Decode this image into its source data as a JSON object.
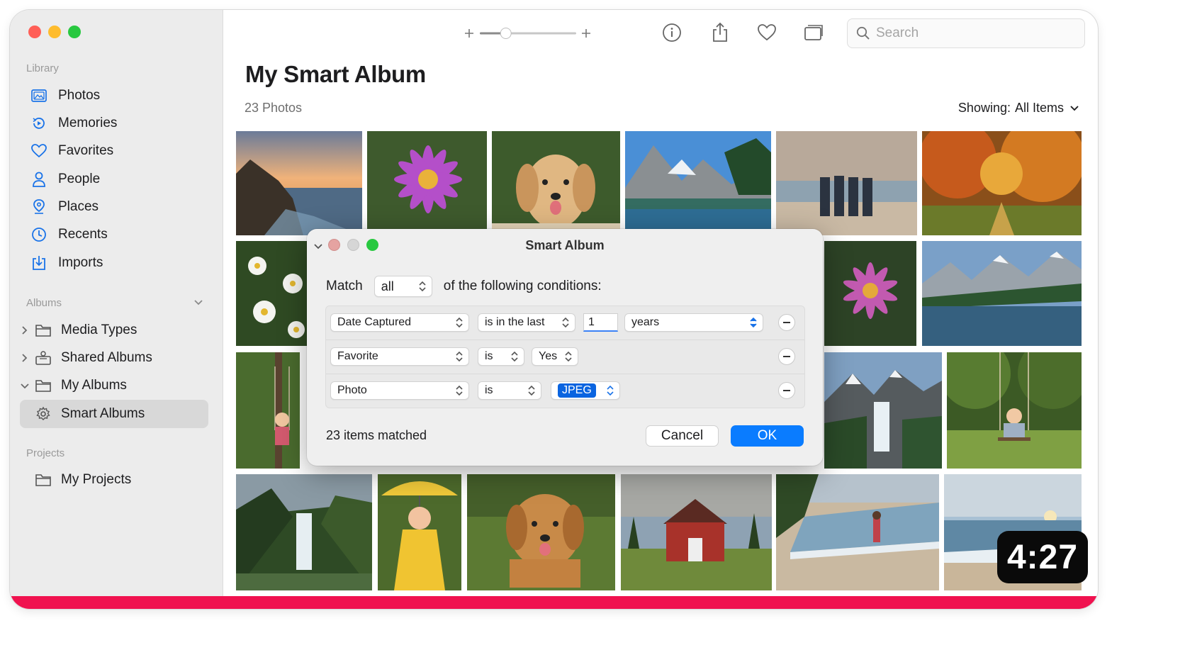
{
  "sidebar": {
    "library_label": "Library",
    "library_items": [
      {
        "label": "Photos",
        "icon": "photos-icon"
      },
      {
        "label": "Memories",
        "icon": "memories-icon"
      },
      {
        "label": "Favorites",
        "icon": "heart-icon"
      },
      {
        "label": "People",
        "icon": "person-icon"
      },
      {
        "label": "Places",
        "icon": "map-pin-icon"
      },
      {
        "label": "Recents",
        "icon": "clock-icon"
      },
      {
        "label": "Imports",
        "icon": "import-icon"
      }
    ],
    "albums_label": "Albums",
    "album_items": [
      {
        "label": "Media Types",
        "icon": "folder-icon",
        "expanded": false
      },
      {
        "label": "Shared Albums",
        "icon": "shared-albums-icon",
        "expanded": false
      },
      {
        "label": "My Albums",
        "icon": "folder-icon",
        "expanded": true
      },
      {
        "label": "Smart Albums",
        "icon": "gear-icon",
        "selected": true
      }
    ],
    "projects_label": "Projects",
    "project_items": [
      {
        "label": "My Projects",
        "icon": "folder-icon"
      }
    ]
  },
  "toolbar": {
    "search_placeholder": "Search",
    "zoom_level": 0.27
  },
  "main": {
    "title": "My Smart Album",
    "count": "23 Photos",
    "showing_label": "Showing:",
    "showing_value": "All Items"
  },
  "photos": [
    "coastal sunset",
    "purple flower",
    "golden retriever puppy",
    "mountain lake",
    "people on beach",
    "autumn trees",
    "daisies",
    "purple flower",
    "mountain lake reflection",
    "girl on swing",
    "waterfall in mountains",
    "child on swing",
    "forest waterfall",
    "child in yellow raincoat",
    "golden puppy",
    "red barn",
    "woman on beach",
    "ocean waves"
  ],
  "dialog": {
    "title": "Smart Album",
    "match_label": "Match",
    "match_value": "all",
    "match_suffix": "of the following conditions:",
    "conditions": [
      {
        "field": "Date Captured",
        "operator": "is in the last",
        "value": "1",
        "unit": "years"
      },
      {
        "field": "Favorite",
        "operator": "is",
        "value": "Yes"
      },
      {
        "field": "Photo",
        "operator": "is",
        "value": "JPEG"
      }
    ],
    "matched": "23 items matched",
    "cancel": "Cancel",
    "ok": "OK"
  },
  "video": {
    "time": "4:27",
    "progress_color": "#f0124f"
  },
  "colors": {
    "accent": "#0a7cff",
    "close": "#ff5f57",
    "minimize": "#febc2e",
    "zoom": "#28c840"
  }
}
